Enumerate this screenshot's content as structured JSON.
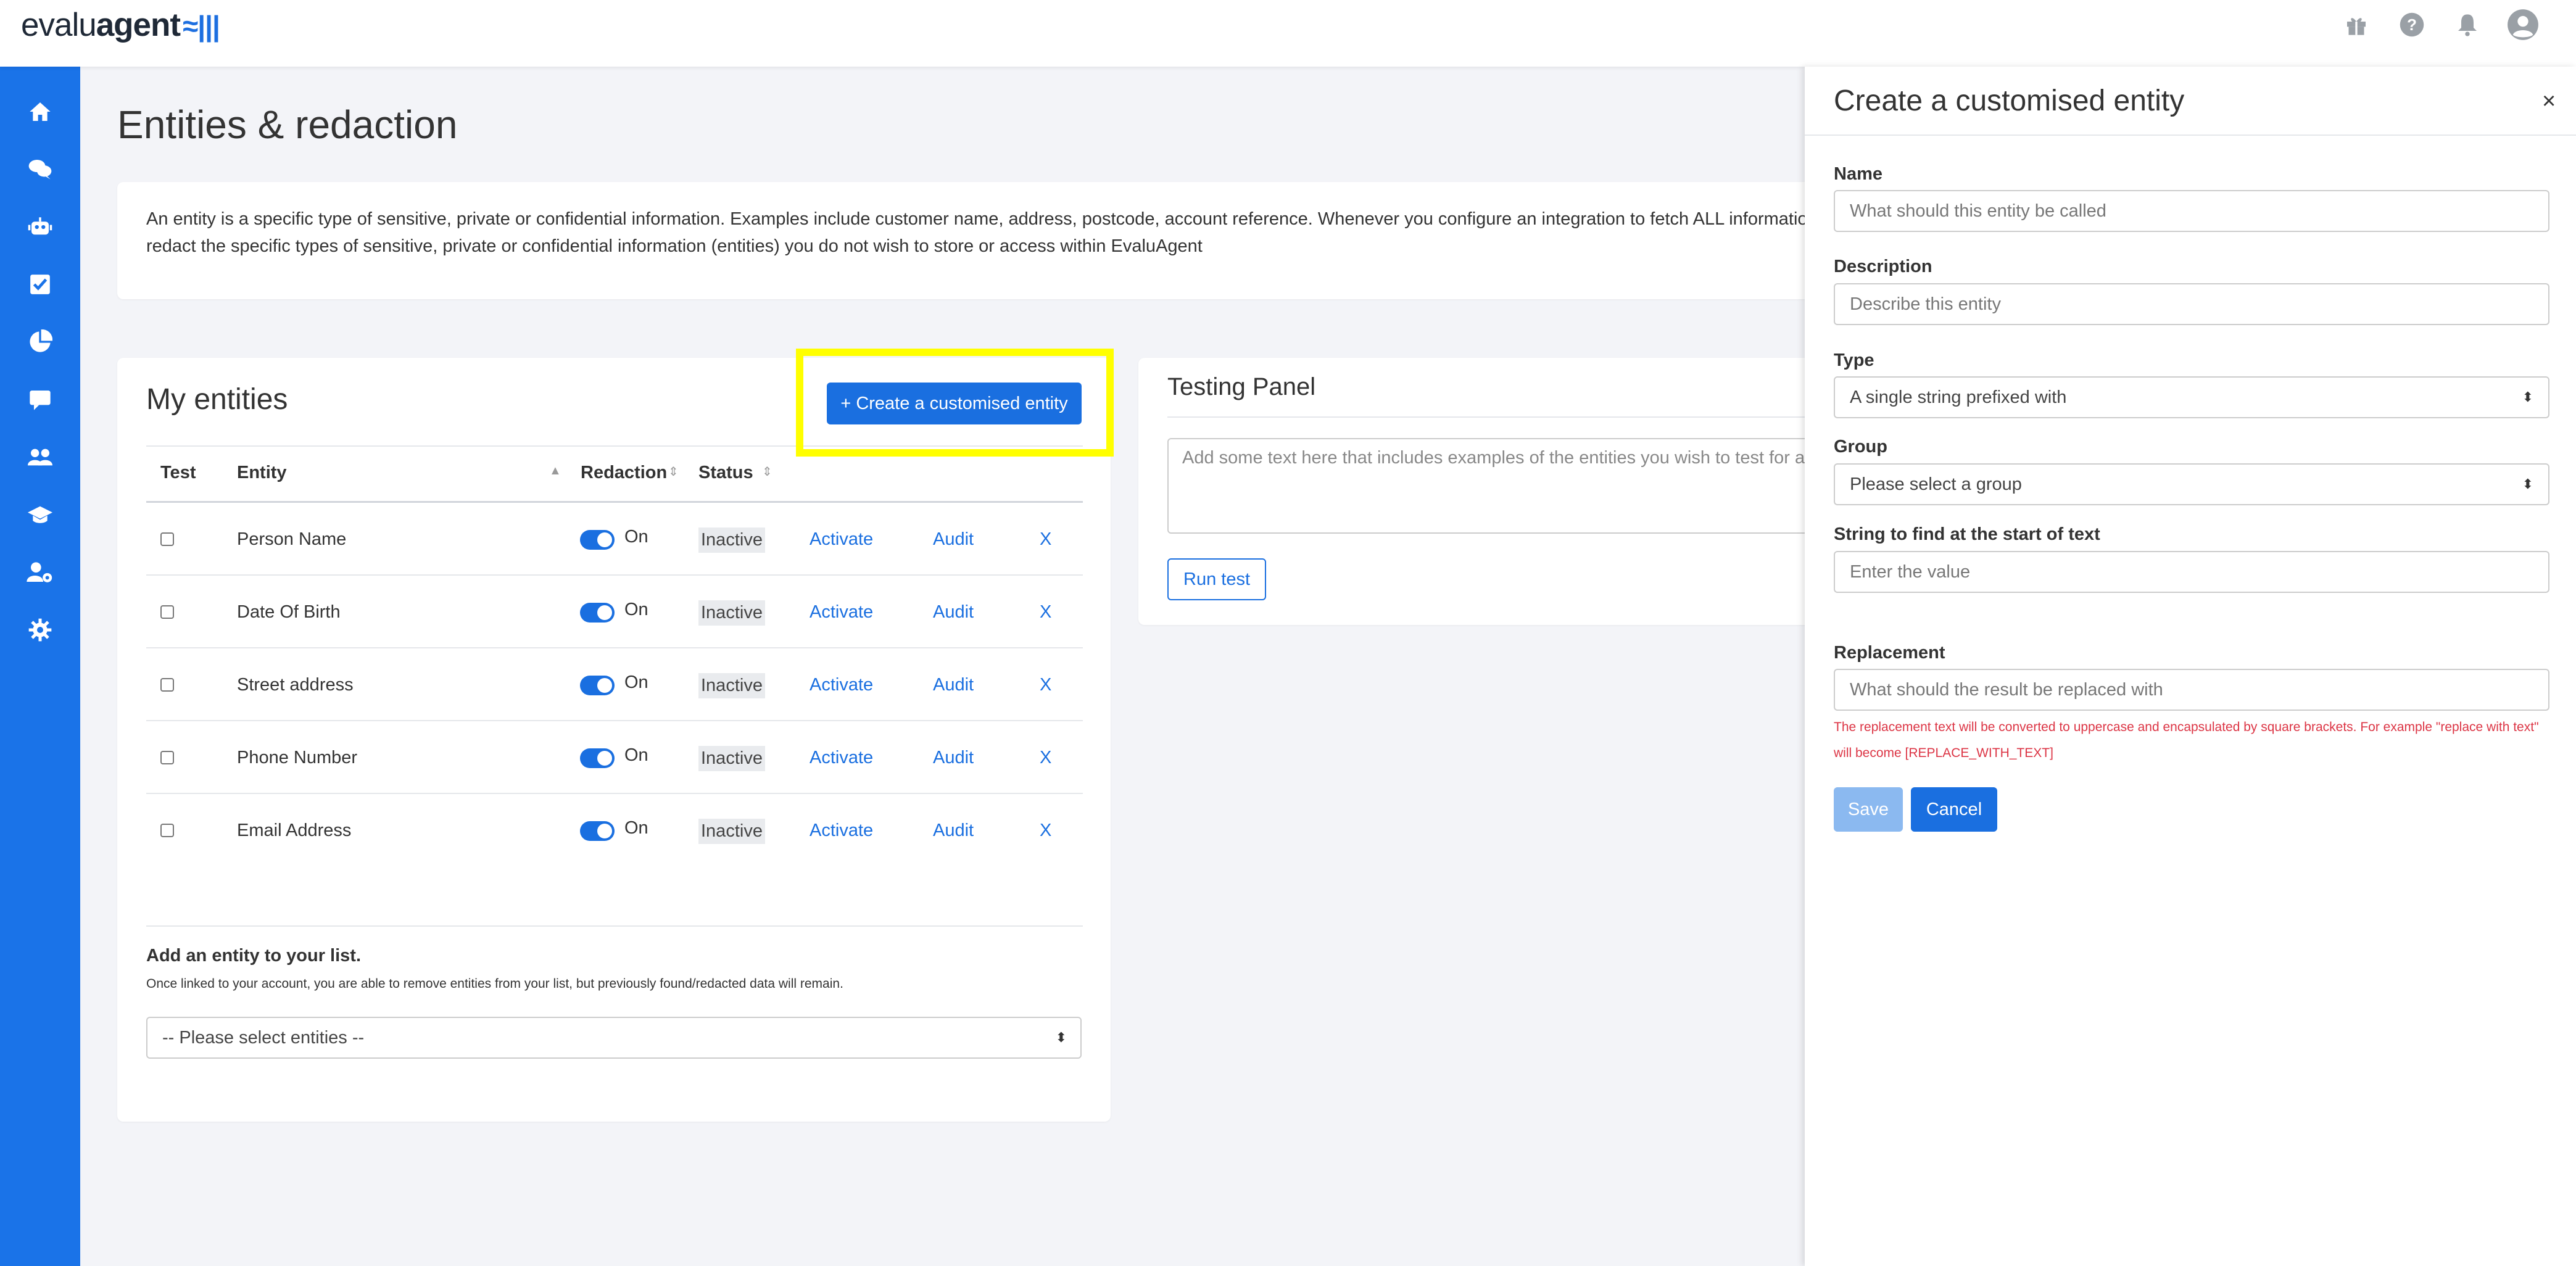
{
  "app": {
    "logo_text_light": "evalu",
    "logo_text_bold": "agent",
    "logo_mark": "≈|||"
  },
  "topbar_icons": [
    "gift-icon",
    "help-icon",
    "bell-icon",
    "user-avatar-icon"
  ],
  "sidebar": {
    "items": [
      "home-icon",
      "chat-icon",
      "robot-icon",
      "checklist-icon",
      "pie-chart-icon",
      "message-icon",
      "users-icon",
      "graduation-icon",
      "user-settings-icon",
      "gear-icon"
    ]
  },
  "page": {
    "title": "Entities & redaction",
    "intro": "An entity is a specific type of sensitive, private or confidential information. Examples include customer name, address, postcode, account reference. Whenever you configure an integration to fetch ALL information\nredact the specific types of sensitive, private or confidential information (entities) you do not wish to store or access within EvaluAgent"
  },
  "entities": {
    "title": "My entities",
    "create_button": "+ Create a customised entity",
    "headers": {
      "test": "Test",
      "entity": "Entity",
      "redaction": "Redaction",
      "status": "Status"
    },
    "toggle_label": "On",
    "rows": [
      {
        "name": "Person Name",
        "status": "Inactive",
        "activate": "Activate",
        "audit": "Audit",
        "remove": "X"
      },
      {
        "name": "Date Of Birth",
        "status": "Inactive",
        "activate": "Activate",
        "audit": "Audit",
        "remove": "X"
      },
      {
        "name": "Street address",
        "status": "Inactive",
        "activate": "Activate",
        "audit": "Audit",
        "remove": "X"
      },
      {
        "name": "Phone Number",
        "status": "Inactive",
        "activate": "Activate",
        "audit": "Audit",
        "remove": "X"
      },
      {
        "name": "Email Address",
        "status": "Inactive",
        "activate": "Activate",
        "audit": "Audit",
        "remove": "X"
      }
    ],
    "add_title": "Add an entity to your list.",
    "add_desc": "Once linked to your account, you are able to remove entities from your list, but previously found/redacted data will remain.",
    "add_select": "-- Please select entities --"
  },
  "testing": {
    "title": "Testing Panel",
    "placeholder": "Add some text here that includes examples of the entities you wish to test for a",
    "run_button": "Run test"
  },
  "panel": {
    "title": "Create a customised entity",
    "close": "×",
    "name_label": "Name",
    "name_placeholder": "What should this entity be called",
    "desc_label": "Description",
    "desc_placeholder": "Describe this entity",
    "type_label": "Type",
    "type_value": "A single string prefixed with",
    "group_label": "Group",
    "group_value": "Please select a group",
    "string_label": "String to find at the start of text",
    "string_placeholder": "Enter the value",
    "replacement_label": "Replacement",
    "replacement_placeholder": "What should the result be replaced with",
    "hint": "The replacement text will be converted to uppercase and encapsulated by square brackets. For example \"replace with text\" will become [REPLACE_WITH_TEXT]",
    "save_button": "Save",
    "cancel_button": "Cancel"
  },
  "colors": {
    "accent": "#1a6fe0",
    "sidebar": "#1a73e8",
    "highlight": "#ffff00",
    "error": "#dc3545"
  }
}
